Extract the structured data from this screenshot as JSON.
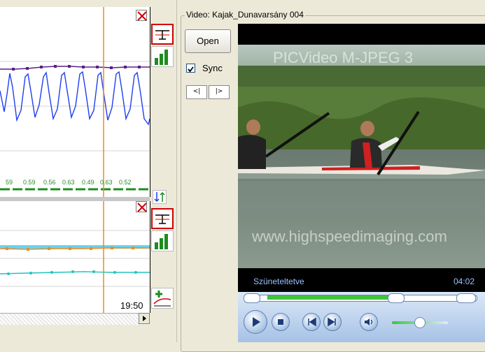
{
  "top_pane": {
    "values": [
      "59",
      "0.59",
      "0.56",
      "0.63",
      "0.49",
      "0.63",
      "0.52"
    ]
  },
  "bottom_pane": {
    "time_label": "19:50"
  },
  "video_group": {
    "title": "Video: Kajak_Dunavarsány 004",
    "open_label": "Open",
    "sync_label": "Sync",
    "sync_checked": true,
    "step_back_label": "<|",
    "step_forward_label": "|>",
    "watermark_top": "PICVideo M-JPEG 3",
    "watermark_bottom": "www.highspeedimaging.com",
    "player_status": "Szüneteltetve",
    "player_time": "04:02"
  },
  "colors": {
    "cursor": "#f08a1e",
    "series_blue": "#1f3ff0",
    "series_purple": "#5a1e8c",
    "series_orange": "#f08a1e",
    "series_teal": "#20c4c0",
    "band_cyan": "#66d4f0",
    "label_green": "#2c8a2c"
  }
}
